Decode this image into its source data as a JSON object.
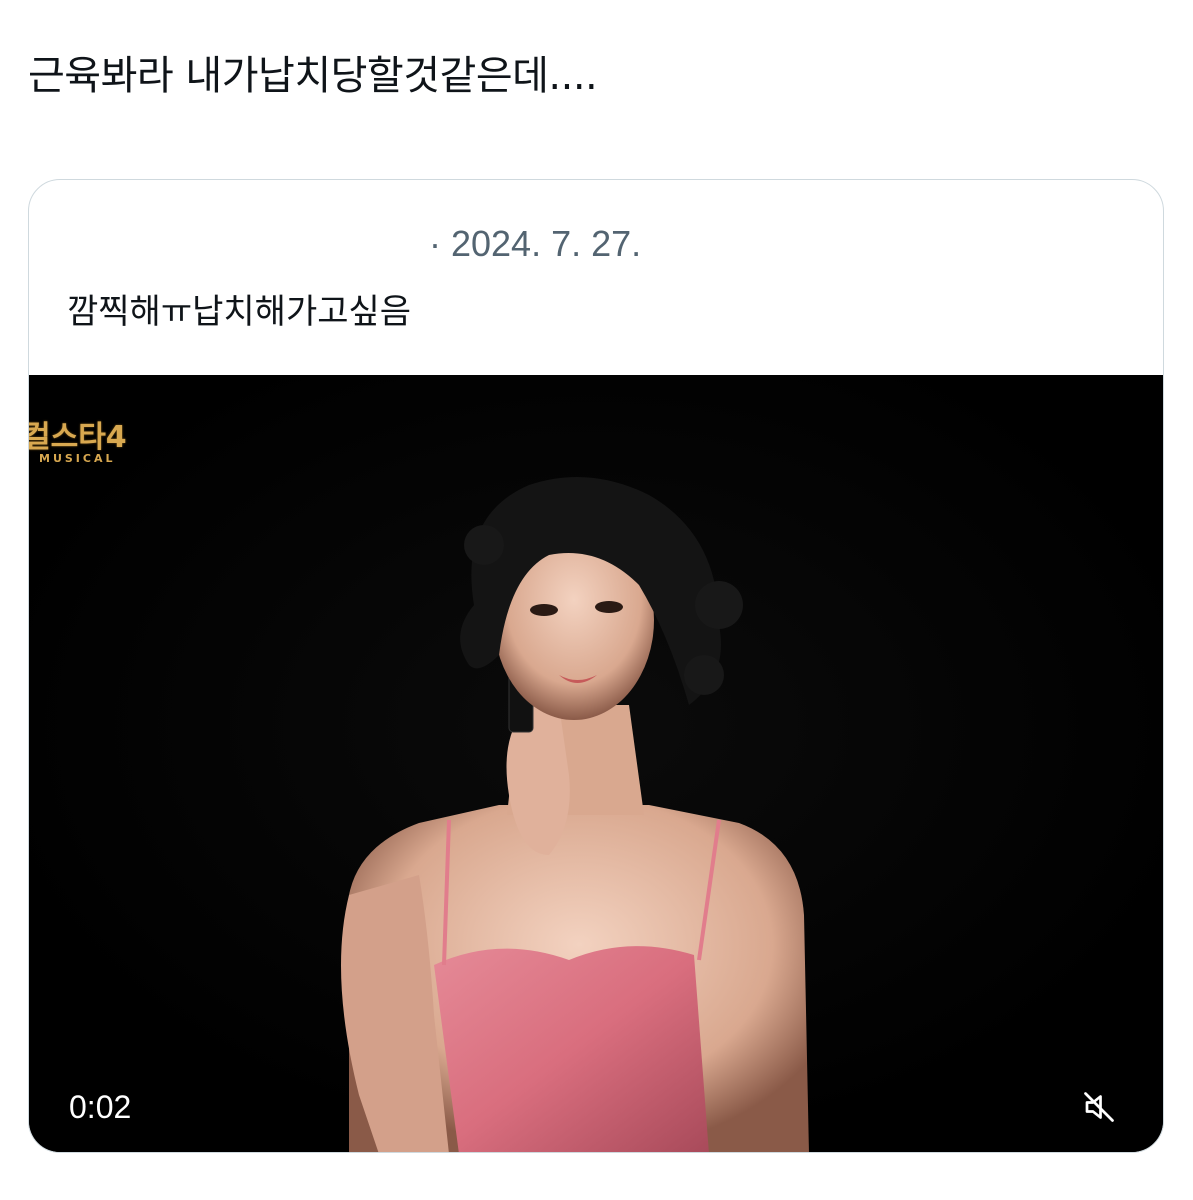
{
  "post": {
    "text": "근육봐라 내가납치당할것같은데...."
  },
  "quoted_post": {
    "date": "· 2024. 7. 27.",
    "text": "깜찍해ㅠ납치해가고싶음"
  },
  "video": {
    "show_logo_title": "컬스타4",
    "show_logo_subtitle": "MUSICAL",
    "timestamp": "0:02",
    "mute_icon": "speaker-muted-icon"
  },
  "colors": {
    "text_primary": "#0f1419",
    "text_secondary": "#536471",
    "card_border": "#cfd9de",
    "dress_pink": "#d96e7e",
    "logo_gold": "#d8a850"
  }
}
